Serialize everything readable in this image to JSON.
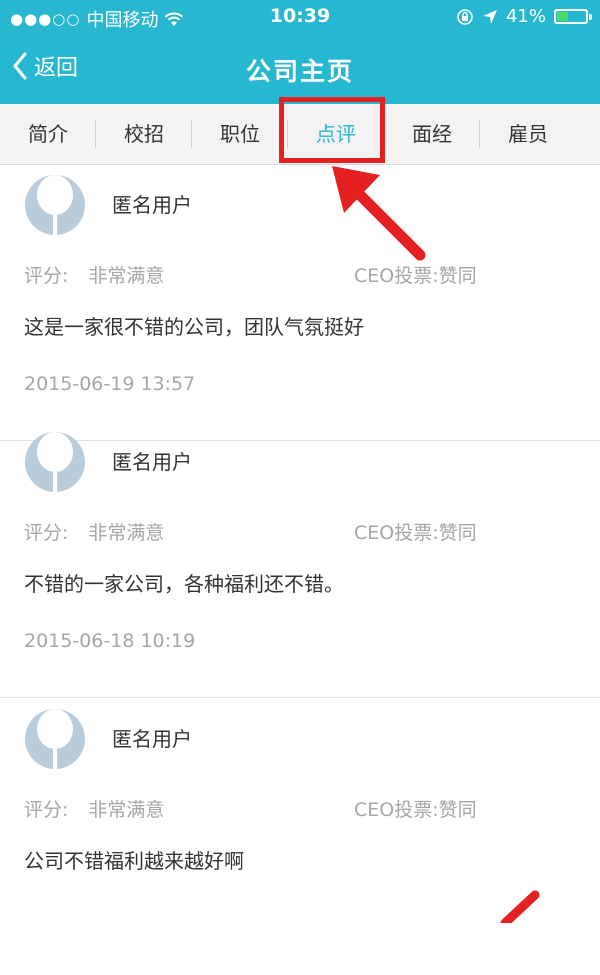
{
  "status_bar": {
    "carrier": "中国移动",
    "time": "10:39",
    "battery": "41%",
    "battery_level": 0.41
  },
  "nav": {
    "back_label": "返回",
    "title": "公司主页"
  },
  "tabs": [
    {
      "label": "简介"
    },
    {
      "label": "校招"
    },
    {
      "label": "职位"
    },
    {
      "label": "点评"
    },
    {
      "label": "面经"
    },
    {
      "label": "雇员"
    }
  ],
  "active_tab": "点评",
  "reviews": [
    {
      "user": "匿名用户",
      "rating_label": "评分:",
      "rating": "非常满意",
      "ceo_vote": "CEO投票:赞同",
      "comment": "这是一家很不错的公司，团队气氛挺好",
      "date": "2015-06-19 13:57"
    },
    {
      "user": "匿名用户",
      "rating_label": "评分:",
      "rating": "非常满意",
      "ceo_vote": "CEO投票:赞同",
      "comment": "不错的一家公司，各种福利还不错。",
      "date": "2015-06-18 10:19"
    },
    {
      "user": "匿名用户",
      "rating_label": "评分:",
      "rating": "非常满意",
      "ceo_vote": "CEO投票:赞同",
      "comment": "公司不错福利越来越好啊",
      "date": ""
    }
  ],
  "colors": {
    "brand": "#27b7d1",
    "annotation": "#e52020",
    "muted_text": "#a6a6a6"
  },
  "icons": [
    "signal-dots-icon",
    "wifi-icon",
    "lock-rotation-icon",
    "location-arrow-icon",
    "battery-icon",
    "back-chevron-icon",
    "avatar-icon",
    "annotation-arrow-icon"
  ]
}
